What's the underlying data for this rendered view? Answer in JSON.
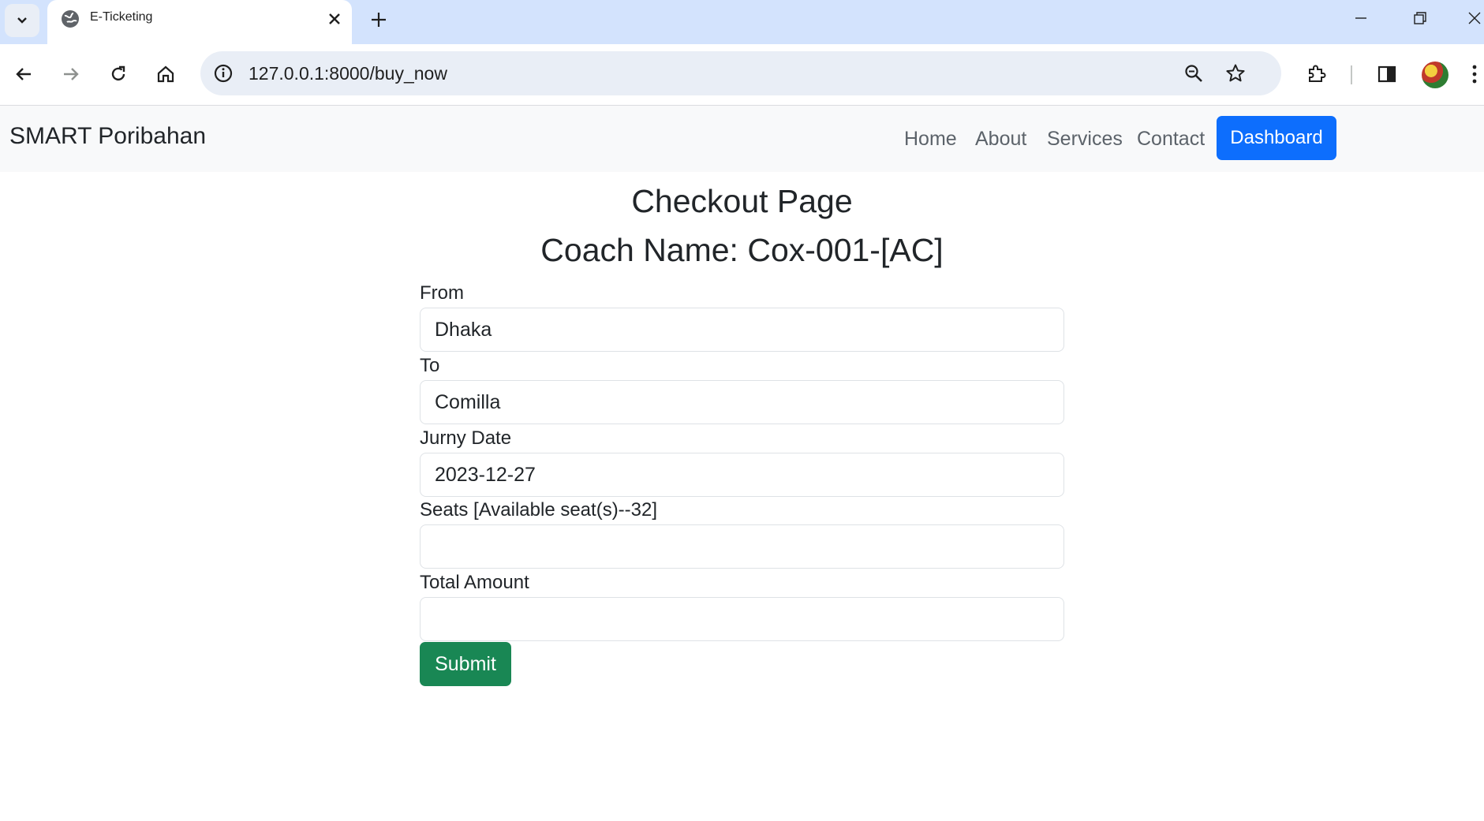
{
  "browser": {
    "tab_title": "E-Ticketing",
    "url": "127.0.0.1:8000/buy_now"
  },
  "navbar": {
    "brand": "SMART Poribahan",
    "links": [
      "Home",
      "About",
      "Services",
      "Contact"
    ],
    "dashboard_label": "Dashboard"
  },
  "checkout": {
    "title": "Checkout Page",
    "coach_name": "Coach Name: Cox-001-[AC]",
    "fields": {
      "from_label": "From",
      "from_value": "Dhaka",
      "to_label": "To",
      "to_value": "Comilla",
      "date_label": "Jurny Date",
      "date_value": "2023-12-27",
      "seats_label": "Seats [Available seat(s)--32]",
      "seats_value": "",
      "amount_label": "Total Amount",
      "amount_value": ""
    },
    "submit_label": "Submit"
  },
  "colors": {
    "primary": "#0d6efd",
    "success": "#198754",
    "navbar_bg": "#f8f9fa",
    "tabstrip_bg": "#d3e3fd"
  },
  "icons": [
    "tab-search-icon",
    "globe-icon",
    "close-icon",
    "plus-icon",
    "minimize-icon",
    "restore-icon",
    "back-icon",
    "forward-icon",
    "reload-icon",
    "home-icon",
    "info-icon",
    "zoom-icon",
    "star-icon",
    "extensions-icon",
    "side-panel-icon",
    "menu-icon"
  ]
}
